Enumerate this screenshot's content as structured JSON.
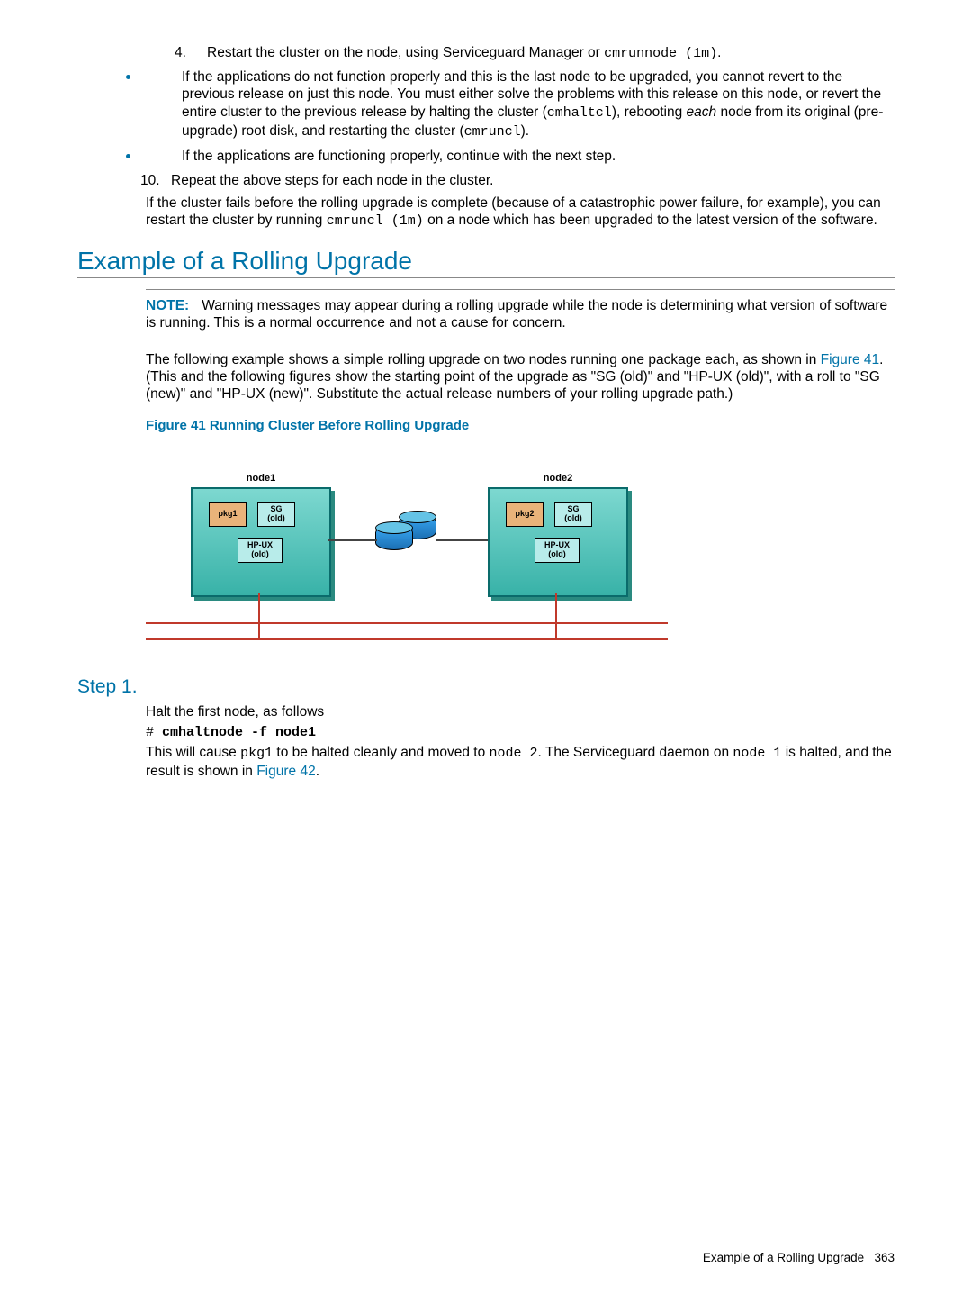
{
  "step4": {
    "number": "4.",
    "text_pre": "Restart the cluster on the node, using Serviceguard Manager or ",
    "code": "cmrunnode (1m)",
    "post": "."
  },
  "bullet_a": {
    "t1": "If the applications do not function properly and this is the last node to be upgraded, you cannot revert to the previous release on just this node. You must either solve the problems with this release on this node, or revert the entire cluster to the previous release by halting the cluster (",
    "c1": "cmhaltcl",
    "t2": "), rebooting ",
    "em": "each",
    "t3": " node from its original (pre-upgrade) root disk, and restarting the cluster (",
    "c2": "cmruncl",
    "t4": ")."
  },
  "bullet_b": "If the applications are functioning properly, continue with the next step.",
  "step10": {
    "number": "10.",
    "text": "Repeat the above steps for each node in the cluster."
  },
  "cluster_fail": {
    "t1": "If the cluster fails before the rolling upgrade is complete (because of a catastrophic power failure, for example), you can restart the cluster by running ",
    "c1": "cmruncl (1m)",
    "t2": " on a node which has been upgraded to the latest version of the software."
  },
  "h2_example": "Example of a Rolling Upgrade",
  "note": {
    "label": "NOTE:",
    "text": "Warning messages may appear during a rolling upgrade while the node is determining what version of software is running. This is a normal occurrence and not a cause for concern."
  },
  "example_para": {
    "t1": "The following example shows a simple rolling upgrade on two nodes running one package each, as shown in ",
    "link": "Figure 41",
    "t2": ". (This and the following figures show the starting point of the upgrade as \"SG (old)\" and \"HP-UX (old)\", with a roll to \"SG (new)\" and \"HP-UX (new)\". Substitute the actual release numbers of your rolling upgrade path.)"
  },
  "fig41_caption": "Figure 41 Running Cluster Before Rolling Upgrade",
  "fig41": {
    "node1": {
      "title": "node1",
      "pkg": "pkg1",
      "sg": "SG\n(old)",
      "hpux": "HP-UX\n(old)"
    },
    "node2": {
      "title": "node2",
      "pkg": "pkg2",
      "sg": "SG\n(old)",
      "hpux": "HP-UX\n(old)"
    }
  },
  "step1_heading": "Step 1.",
  "step1_p1": "Halt the first node, as follows",
  "step1_cmd": {
    "hash": "# ",
    "cmd": "cmhaltnode -f node1"
  },
  "step1_p2": {
    "t1": "This will cause ",
    "c1": "pkg1",
    "t2": " to be halted cleanly and moved to ",
    "c2": "node 2",
    "t3": ". The Serviceguard daemon on ",
    "c3": "node 1",
    "t4": " is halted, and the result is shown in ",
    "link": "Figure 42",
    "t5": "."
  },
  "footer": {
    "text": "Example of a Rolling Upgrade",
    "page": "363"
  }
}
